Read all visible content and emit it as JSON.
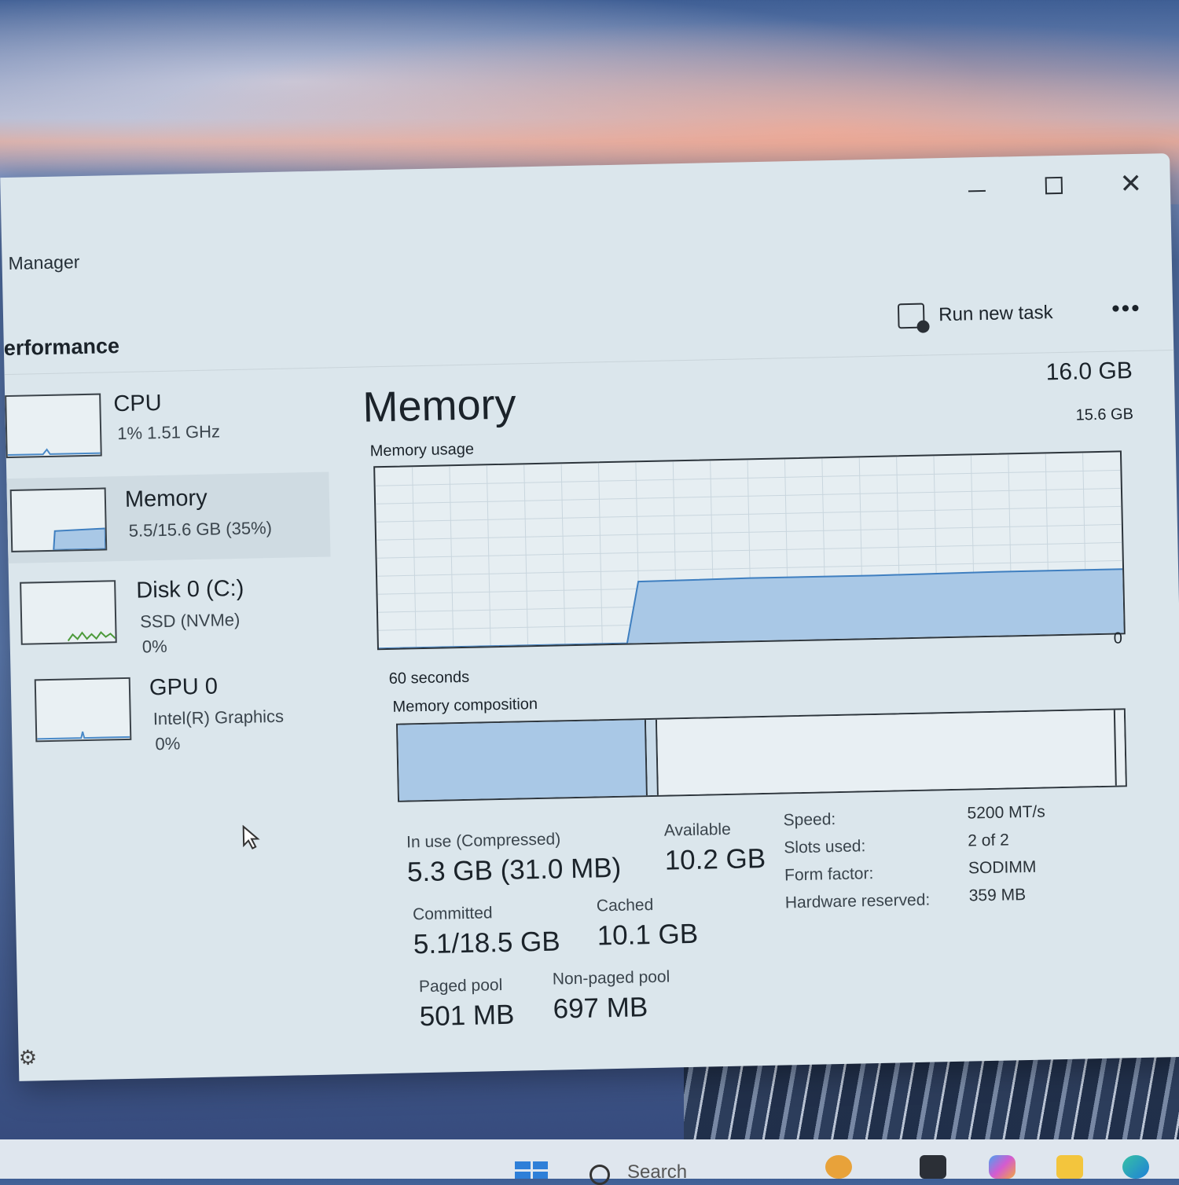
{
  "window": {
    "title": "Manager",
    "controls": {
      "minimize": "minimize",
      "maximize": "maximize",
      "close": "✕"
    }
  },
  "toolbar": {
    "section_title": "erformance",
    "run_new_task": "Run new task",
    "more": "•••"
  },
  "sidebar": {
    "items": [
      {
        "name": "CPU",
        "sub1": "1%  1.51 GHz",
        "sub2": "",
        "level": 0.01,
        "active": false
      },
      {
        "name": "Memory",
        "sub1": "5.5/15.6 GB (35%)",
        "sub2": "",
        "level": 0.35,
        "active": true
      },
      {
        "name": "Disk 0 (C:)",
        "sub1": "SSD (NVMe)",
        "sub2": "0%",
        "level": 0.0,
        "active": false
      },
      {
        "name": "GPU 0",
        "sub1": "Intel(R) Graphics",
        "sub2": "0%",
        "level": 0.0,
        "active": false
      }
    ]
  },
  "main": {
    "title": "Memory",
    "total": "16.0 GB",
    "usage_label": "Memory usage",
    "usage_max": "15.6 GB",
    "axis_left": "60 seconds",
    "axis_right": "0",
    "composition_label": "Memory composition",
    "composition": {
      "in_use_fraction": 0.34,
      "modified_fraction": 0.013,
      "free_fraction": 0.012
    },
    "stats": {
      "in_use_label": "In use (Compressed)",
      "in_use_value": "5.3 GB (31.0 MB)",
      "available_label": "Available",
      "available_value": "10.2 GB",
      "committed_label": "Committed",
      "committed_value": "5.1/18.5 GB",
      "cached_label": "Cached",
      "cached_value": "10.1 GB",
      "paged_label": "Paged pool",
      "paged_value": "501 MB",
      "nonpaged_label": "Non-paged pool",
      "nonpaged_value": "697 MB"
    },
    "specs": {
      "speed_label": "Speed:",
      "speed_value": "5200 MT/s",
      "slots_label": "Slots used:",
      "slots_value": "2 of 2",
      "form_label": "Form factor:",
      "form_value": "SODIMM",
      "reserved_label": "Hardware reserved:",
      "reserved_value": "359 MB"
    }
  },
  "chart_data": {
    "type": "area",
    "title": "Memory usage",
    "xlabel": "60 seconds",
    "ylabel": "",
    "ylim": [
      0,
      15.6
    ],
    "x": [
      60,
      40,
      39,
      30,
      20,
      10,
      0
    ],
    "values": [
      0,
      0,
      5.3,
      5.4,
      5.4,
      5.5,
      5.5
    ]
  },
  "taskbar": {
    "search": "Search"
  },
  "colors": {
    "graph_fill": "#a9c8e6",
    "graph_line": "#3f7fc0",
    "window_bg": "#dbe6ec"
  }
}
